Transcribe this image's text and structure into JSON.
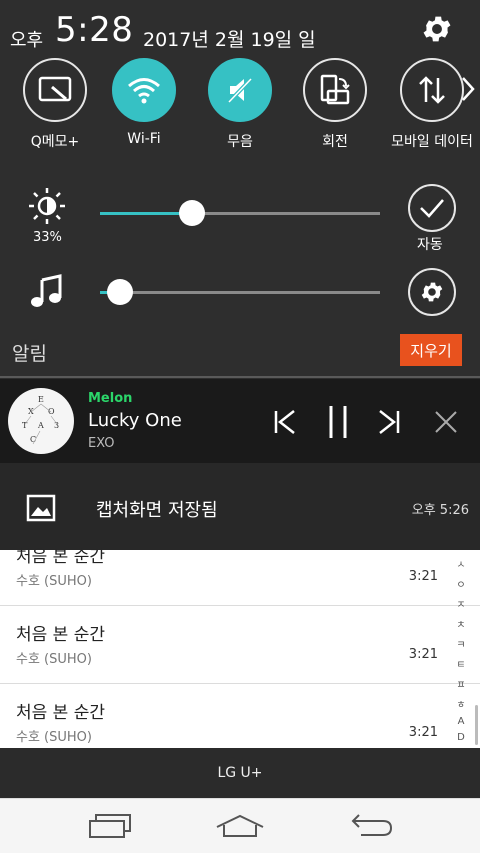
{
  "status_bar": {
    "ampm": "오후",
    "time": "5:28",
    "date": "2017년 2월 19일 일"
  },
  "quick_settings": [
    {
      "label": "Q메모+",
      "icon": "qmemo-icon",
      "on": false
    },
    {
      "label": "Wi-Fi",
      "icon": "wifi-icon",
      "on": true
    },
    {
      "label": "무음",
      "icon": "mute-icon",
      "on": true
    },
    {
      "label": "회전",
      "icon": "rotate-icon",
      "on": false
    },
    {
      "label": "모바일 데이터",
      "icon": "mobile-data-icon",
      "on": false
    }
  ],
  "brightness": {
    "percent_label": "33%",
    "level": 0.33,
    "auto_label": "자동"
  },
  "volume": {
    "level": 0.07
  },
  "notifications_header": {
    "title": "알림",
    "clear_label": "지우기"
  },
  "music_notification": {
    "app": "Melon",
    "song": "Lucky One",
    "artist": "EXO",
    "album_letters": [
      "E",
      "X",
      "O",
      "T",
      "A",
      "C",
      "3"
    ]
  },
  "capture_notification": {
    "text": "캡처화면 저장됨",
    "time": "오후 5:26"
  },
  "background_list": [
    {
      "title": "처음 본 순간",
      "artist": "수호 (SUHO)",
      "duration": "3:21"
    },
    {
      "title": "처음 본 순간",
      "artist": "수호 (SUHO)",
      "duration": "3:21"
    },
    {
      "title": "처음 본 순간",
      "artist": "수호 (SUHO)",
      "duration": "3:21"
    }
  ],
  "index_letters": [
    "ㅅ",
    "ㅇ",
    "ㅈ",
    "ㅊ",
    "ㅋ",
    "ㅌ",
    "ㅍ",
    "ㅎ",
    "A",
    "D"
  ],
  "carrier": "LG U+",
  "colors": {
    "accent": "#36c1c4",
    "clear_button": "#e8521e",
    "melon_green": "#2bd66a"
  }
}
